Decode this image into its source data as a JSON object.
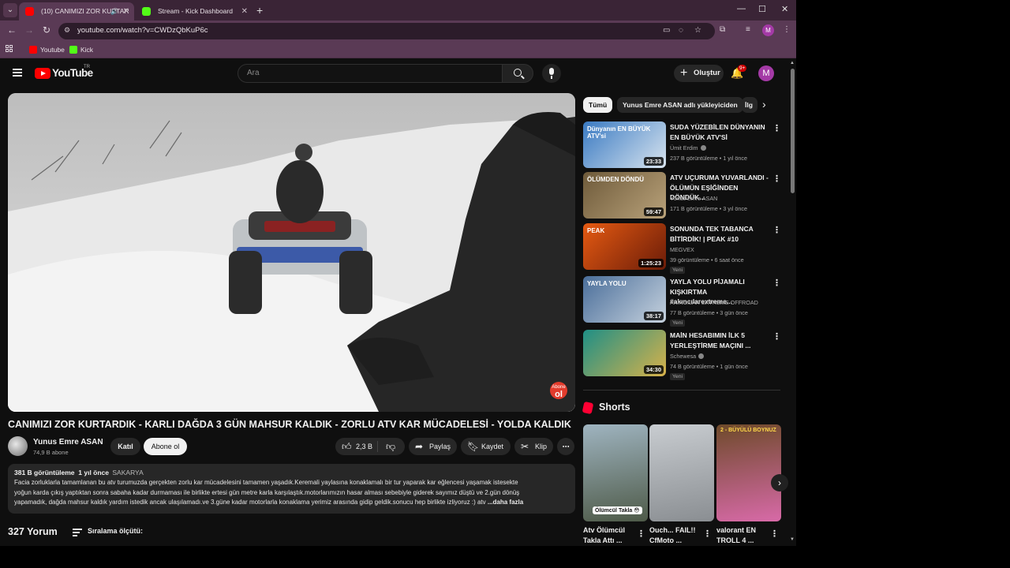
{
  "browser": {
    "tabs": [
      {
        "title": "(10) CANIMIZI ZOR KURTAR",
        "active": true
      },
      {
        "title": "Stream - Kick Dashboard",
        "active": false
      }
    ],
    "url": "youtube.com/watch?v=CWDzQbKuP6c",
    "profile_initial": "M",
    "bookmarks": [
      "Youtube",
      "Kick"
    ]
  },
  "youtube": {
    "logo_text": "YouTube",
    "country_code": "TR",
    "search_placeholder": "Ara",
    "create_label": "Oluştur",
    "notifications_badge": "9+",
    "avatar_initial": "M"
  },
  "video": {
    "title": "CANIMIZI ZOR KURTARDIK - KARLI DAĞDA 3 GÜN MAHSUR KALDIK - ZORLU ATV KAR MÜCADELESİ - YOLDA KALDIK",
    "channel": "Yunus Emre ASAN",
    "subscribers": "74,9 B abone",
    "join_label": "Katıl",
    "subscribe_label": "Abone ol",
    "likes": "2,3 B",
    "share_label": "Paylaş",
    "save_label": "Kaydet",
    "clip_label": "Klip",
    "watermark_top": "Abone",
    "watermark_bottom": "ol",
    "views": "381 B görüntüleme",
    "age": "1 yıl önce",
    "location": "SAKARYA",
    "description_lines": [
      "Facia zorluklarla tamamlanan bu atv turumuzda gerçekten zorlu kar mücadelesini tamamen yaşadık.Keremali yaylasına konaklamalı bir tur yaparak kar eğlencesi yaşamak istesekte",
      "yoğun karda çıkış yaptıktan sonra sabaha kadar durmaması ile birlikte ertesi gün metre karla karşılaştık.motorlarımızın hasar alması sebebiyle giderek sayımız düştü ve 2.gün dönüş",
      "yapamadık, dağda mahsur kaldık yardım istedik ancak ulaşılamadı.ve 3.güne kadar motorlarla konaklama yerimiz arasında gidip geldik.sonucu hep birlikte izliyoruz :) atv"
    ],
    "more_label": "...daha fazla",
    "comments_count": "327 Yorum",
    "sort_label": "Sıralama ölçütü:"
  },
  "chips": [
    "Tümü",
    "Yunus Emre ASAN adlı yükleyiciden",
    "İlg"
  ],
  "related": [
    {
      "title": "SUDA YÜZEBİLEN DÜNYANIN EN BÜYÜK ATV'Sİ",
      "channel": "Ümit Erdim",
      "verified": true,
      "meta": "237 B görüntüleme • 1 yıl önce",
      "duration": "23:33",
      "new": "",
      "thumb_text": "Dünyanın EN BÜYÜK ATV'si",
      "colors": [
        "#3a7ac2",
        "#d8e4ef"
      ]
    },
    {
      "title": "ATV UÇURUMA YUVARLANDI - ÖLÜMÜN EŞİĞİNDEN DÖNDÜK...",
      "channel": "Yunus Emre ASAN",
      "verified": false,
      "meta": "171 B görüntüleme • 3 yıl önce",
      "duration": "59:47",
      "new": "",
      "thumb_text": "ÖLÜMDEN DÖNDÜ",
      "colors": [
        "#6e5a3a",
        "#b9a27a"
      ]
    },
    {
      "title": "SONUNDA TEK TABANCA BİTİRDİK! | PEAK #10",
      "channel": "MEGVEX",
      "verified": false,
      "meta": "39 görüntüleme • 6 saat önce",
      "duration": "1:25:23",
      "new": "Yeni",
      "thumb_text": "PEAK",
      "colors": [
        "#e55a12",
        "#6b1c08"
      ]
    },
    {
      "title": "YAYLA YOLU PİJAMALI KIŞKIRTMA #akıncılarextreme...",
      "channel": "AKINCILAR EXTREME OFFROAD",
      "verified": false,
      "meta": "77 B görüntüleme • 3 gün önce",
      "duration": "38:17",
      "new": "Yeni",
      "thumb_text": "YAYLA YOLU",
      "colors": [
        "#4a6e9a",
        "#c6d2de"
      ]
    },
    {
      "title": "MAİN HESABIMIN İLK 5 YERLEŞTİRME MAÇINI ...",
      "channel": "Schewesa",
      "verified": true,
      "meta": "74 B görüntüleme • 1 gün önce",
      "duration": "34:30",
      "new": "Yeni",
      "thumb_text": "",
      "colors": [
        "#1f8f86",
        "#d8b24a"
      ]
    }
  ],
  "shorts": {
    "heading": "Shorts",
    "items": [
      {
        "title": "Atv Ölümcül Takla Attı ...",
        "overlay": "Ölümcül Takla 😳",
        "colors": [
          "#9fb4c0",
          "#4e5a48"
        ]
      },
      {
        "title": "Ouch... FAIL!! CfMoto ...",
        "overlay": "",
        "colors": [
          "#c8ccd0",
          "#8a8e92"
        ]
      },
      {
        "title": "valorant EN TROLL 4 ...",
        "overlay": "2 - BÜYÜLÜ BOYNUZ",
        "colors": [
          "#6e4a2a",
          "#d86aa8"
        ]
      }
    ]
  }
}
